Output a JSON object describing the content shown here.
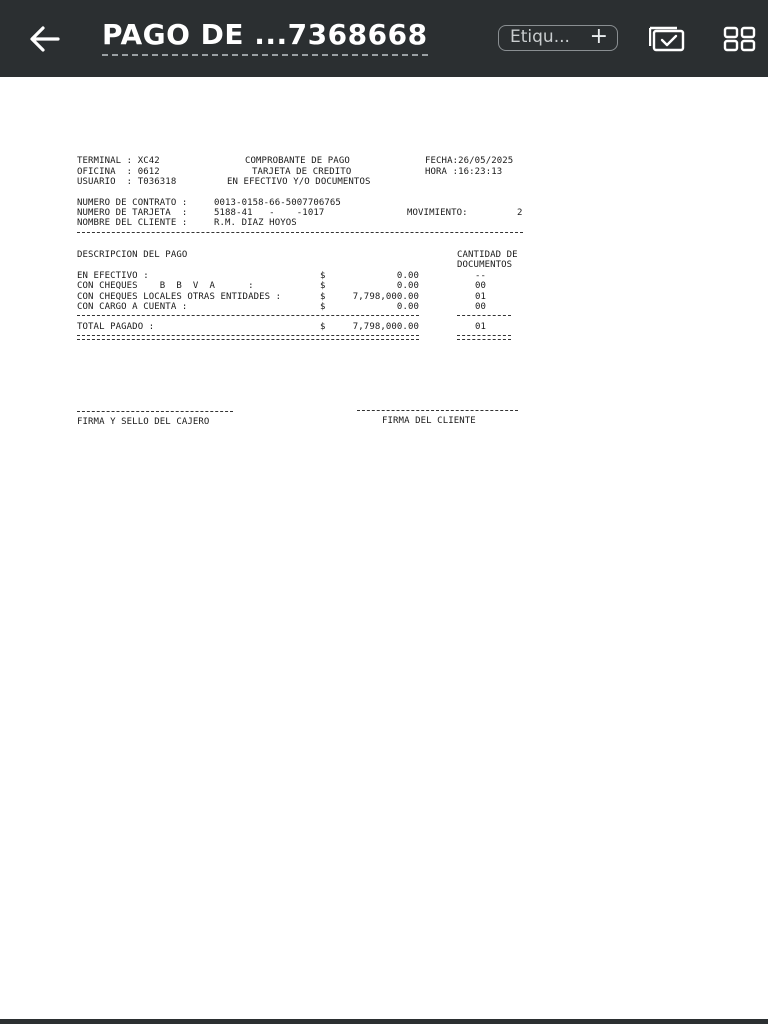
{
  "header": {
    "title": "PAGO DE ...7368668",
    "tag_label": "Etiqu...",
    "tag_plus": "+",
    "icons": [
      "back-arrow-icon",
      "select-icon",
      "grid-view-icon"
    ],
    "background": "#2b2f31"
  },
  "receipt": {
    "terminal": "TERMINAL : XC42",
    "oficina": "OFICINA  : 0612",
    "usuario": "USUARIO  : T036318",
    "title_line1": "COMPROBANTE DE PAGO",
    "title_line2": "TARJETA DE CREDITO",
    "title_line3": "EN EFECTIVO Y/O DOCUMENTOS",
    "fecha": "FECHA:26/05/2025",
    "hora": "HORA :16:23:13",
    "contrato_label": "NUMERO DE CONTRATO :",
    "contrato_value": "0013-0158-66-5007706765",
    "tarjeta_label": "NUMERO DE TARJETA  :",
    "tarjeta_value": "5188-41   -    -1017",
    "movimiento_label": "MOVIMIENTO:",
    "movimiento_value": "2",
    "cliente_label": "NOMBRE DEL CLIENTE :",
    "cliente_value": "R.M. DIAZ HOYOS",
    "descripcion_header": "DESCRIPCION DEL PAGO",
    "cantidad_header_1": "CANTIDAD DE",
    "cantidad_header_2": "DOCUMENTOS",
    "rows": [
      {
        "label": "EN EFECTIVO :",
        "currency": "$",
        "amount": "0.00",
        "docs": "--"
      },
      {
        "label": "CON CHEQUES    B  B  V  A      :",
        "currency": "$",
        "amount": "0.00",
        "docs": "00"
      },
      {
        "label": "CON CHEQUES LOCALES OTRAS ENTIDADES :",
        "currency": "$",
        "amount": "7,798,000.00",
        "docs": "01"
      },
      {
        "label": "CON CARGO A CUENTA :",
        "currency": "$",
        "amount": "0.00",
        "docs": "00"
      }
    ],
    "total_label": "TOTAL PAGADO :",
    "total_currency": "$",
    "total_amount": "7,798,000.00",
    "total_docs": "01",
    "firma_cajero": "FIRMA Y SELLO DEL CAJERO",
    "firma_cliente": "FIRMA DEL CLIENTE"
  }
}
